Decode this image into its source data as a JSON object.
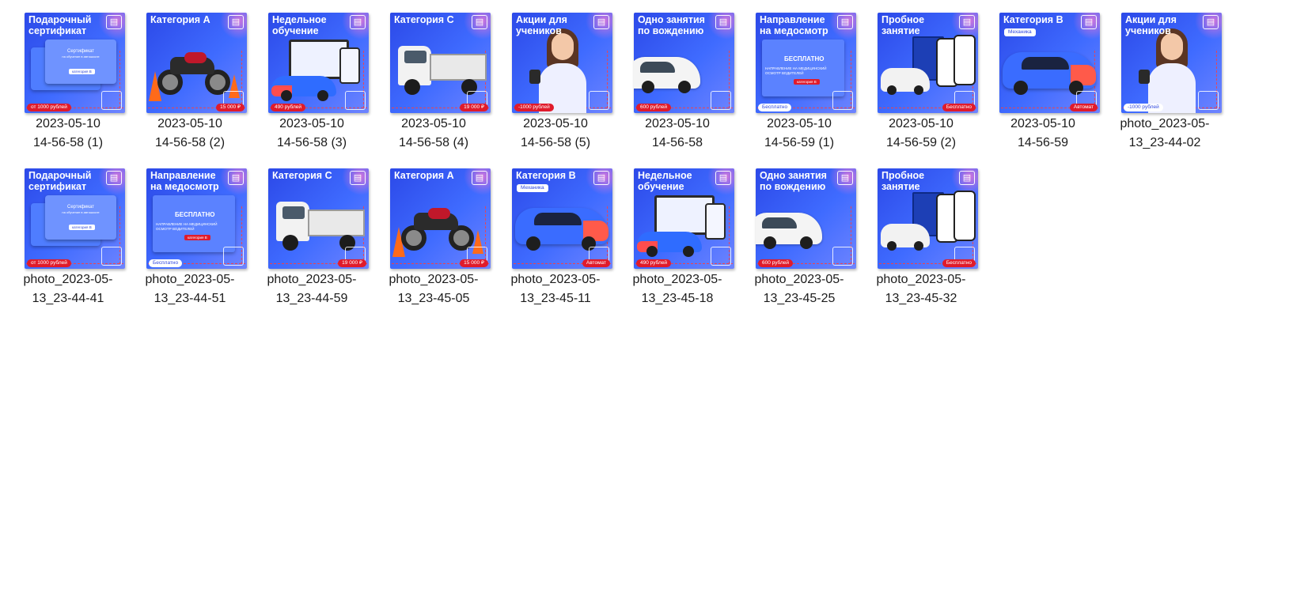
{
  "files": [
    {
      "id": "f1",
      "name_line1": "2023-05-10",
      "name_line2": "14-56-58 (1)",
      "thumb_title": "Подарочный сертификат",
      "thumb_badge": "от 1000 рублей",
      "thumb_kind": "certificate",
      "card_title": "Сертификат",
      "card_sub": "на обучение в автошколе",
      "card_chip": "категория В"
    },
    {
      "id": "f2",
      "name_line1": "2023-05-10",
      "name_line2": "14-56-58 (2)",
      "thumb_title": "Категория А",
      "thumb_badge": "15 000 ₽",
      "thumb_kind": "motorcycle"
    },
    {
      "id": "f3",
      "name_line1": "2023-05-10",
      "name_line2": "14-56-58 (3)",
      "thumb_title": "Недельное обучение",
      "thumb_badge": "490 рублей",
      "thumb_kind": "devices-car"
    },
    {
      "id": "f4",
      "name_line1": "2023-05-10",
      "name_line2": "14-56-58 (4)",
      "thumb_title": "Категория С",
      "thumb_badge": "19 000 ₽",
      "thumb_kind": "truck"
    },
    {
      "id": "f5",
      "name_line1": "2023-05-10",
      "name_line2": "14-56-58 (5)",
      "thumb_title": "Акции для учеников",
      "thumb_badge": "-1000 рублей",
      "thumb_kind": "person"
    },
    {
      "id": "f6",
      "name_line1": "2023-05-10",
      "name_line2": "14-56-58",
      "thumb_title": "Одно занятия по вождению",
      "thumb_badge": "600 рублей",
      "thumb_kind": "white-car"
    },
    {
      "id": "f7",
      "name_line1": "2023-05-10",
      "name_line2": "14-56-59 (1)",
      "thumb_title": "Направление на медосмотр",
      "thumb_badge": "Бесплатно",
      "thumb_kind": "referral",
      "card_title": "БЕСПЛАТНО",
      "card_sub": "НАПРАВЛЕНИЕ НА МЕДИЦИНСКИЙ ОСМОТР ВОДИТЕЛЕЙ",
      "card_chip": "категория В"
    },
    {
      "id": "f8",
      "name_line1": "2023-05-10",
      "name_line2": "14-56-59 (2)",
      "thumb_title": "Пробное занятие",
      "thumb_badge": "Бесплатно",
      "thumb_kind": "book-phones"
    },
    {
      "id": "f9",
      "name_line1": "2023-05-10",
      "name_line2": "14-56-59",
      "thumb_title": "Категория В",
      "thumb_badge": "Автомат",
      "thumb_chip": "Механика",
      "thumb_kind": "blue-car"
    },
    {
      "id": "f10",
      "name_line1": "photo_2023-05-",
      "name_line2": "13_23-44-02",
      "thumb_title": "Акции для учеников",
      "thumb_badge": "-1000 рублей",
      "thumb_kind": "person"
    },
    {
      "id": "f11",
      "name_line1": "photo_2023-05-",
      "name_line2": "13_23-44-41",
      "thumb_title": "Подарочный сертификат",
      "thumb_badge": "от 1000 рублей",
      "thumb_kind": "certificate",
      "card_title": "Сертификат",
      "card_sub": "на обучение в автошколе",
      "card_chip": "категория В"
    },
    {
      "id": "f12",
      "name_line1": "photo_2023-05-",
      "name_line2": "13_23-44-51",
      "thumb_title": "Направление на медосмотр",
      "thumb_badge": "Бесплатно",
      "thumb_kind": "referral",
      "card_title": "БЕСПЛАТНО",
      "card_sub": "НАПРАВЛЕНИЕ НА МЕДИЦИНСКИЙ ОСМОТР ВОДИТЕЛЕЙ",
      "card_chip": "категория В"
    },
    {
      "id": "f13",
      "name_line1": "photo_2023-05-",
      "name_line2": "13_23-44-59",
      "thumb_title": "Категория С",
      "thumb_badge": "19 000 ₽",
      "thumb_kind": "truck"
    },
    {
      "id": "f14",
      "name_line1": "photo_2023-05-",
      "name_line2": "13_23-45-05",
      "thumb_title": "Категория А",
      "thumb_badge": "15 000 ₽",
      "thumb_kind": "motorcycle"
    },
    {
      "id": "f15",
      "name_line1": "photo_2023-05-",
      "name_line2": "13_23-45-11",
      "thumb_title": "Категория В",
      "thumb_badge": "Автомат",
      "thumb_chip": "Механика",
      "thumb_kind": "blue-car"
    },
    {
      "id": "f16",
      "name_line1": "photo_2023-05-",
      "name_line2": "13_23-45-18",
      "thumb_title": "Недельное обучение",
      "thumb_badge": "490 рублей",
      "thumb_kind": "devices-car"
    },
    {
      "id": "f17",
      "name_line1": "photo_2023-05-",
      "name_line2": "13_23-45-25",
      "thumb_title": "Одно занятия по вождению",
      "thumb_badge": "600 рублей",
      "thumb_kind": "white-car"
    },
    {
      "id": "f18",
      "name_line1": "photo_2023-05-",
      "name_line2": "13_23-45-32",
      "thumb_title": "Пробное занятие",
      "thumb_badge": "Бесплатно",
      "thumb_kind": "book-phones"
    }
  ],
  "colors": {
    "thumb_blue": "#3f6bff",
    "thumb_pink": "#ff78d2",
    "badge_red": "#e01b2b",
    "label_text": "#1b1b1b",
    "background": "#ffffff"
  }
}
